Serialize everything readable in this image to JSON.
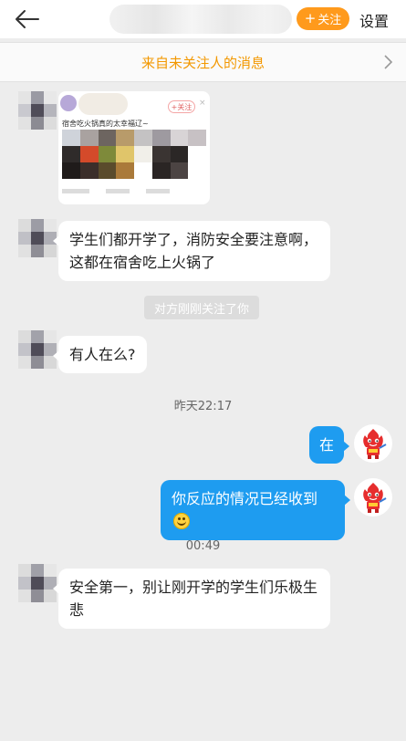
{
  "header": {
    "follow_label": "关注",
    "follow_plus": "+",
    "settings_label": "设置"
  },
  "banner": {
    "text": "来自未关注人的消息"
  },
  "shared_card": {
    "follow_tag": "+关注",
    "caption": "宿舍吃火锅真的太幸福辽~"
  },
  "messages": {
    "m1": "学生们都开学了，消防安全要注意啊，这都在宿舍吃上火锅了",
    "system_note": "对方刚刚关注了你",
    "m2": "有人在么?",
    "time1": "昨天22:17",
    "m3": "在",
    "m4": "你反应的情况已经收到",
    "time2": "00:49",
    "m5": "安全第一，别让刚开学的学生们乐极生悲"
  },
  "colors": {
    "accent_orange": "#ff9a1c",
    "banner_text": "#f39800",
    "my_bubble": "#1e9cf0",
    "background": "#ededed"
  },
  "icons": {
    "back": "back-arrow-icon",
    "banner_chevron": "chevron-right-icon",
    "emoji": "smile-emoji-icon",
    "my_avatar": "fire-mascot-avatar"
  }
}
